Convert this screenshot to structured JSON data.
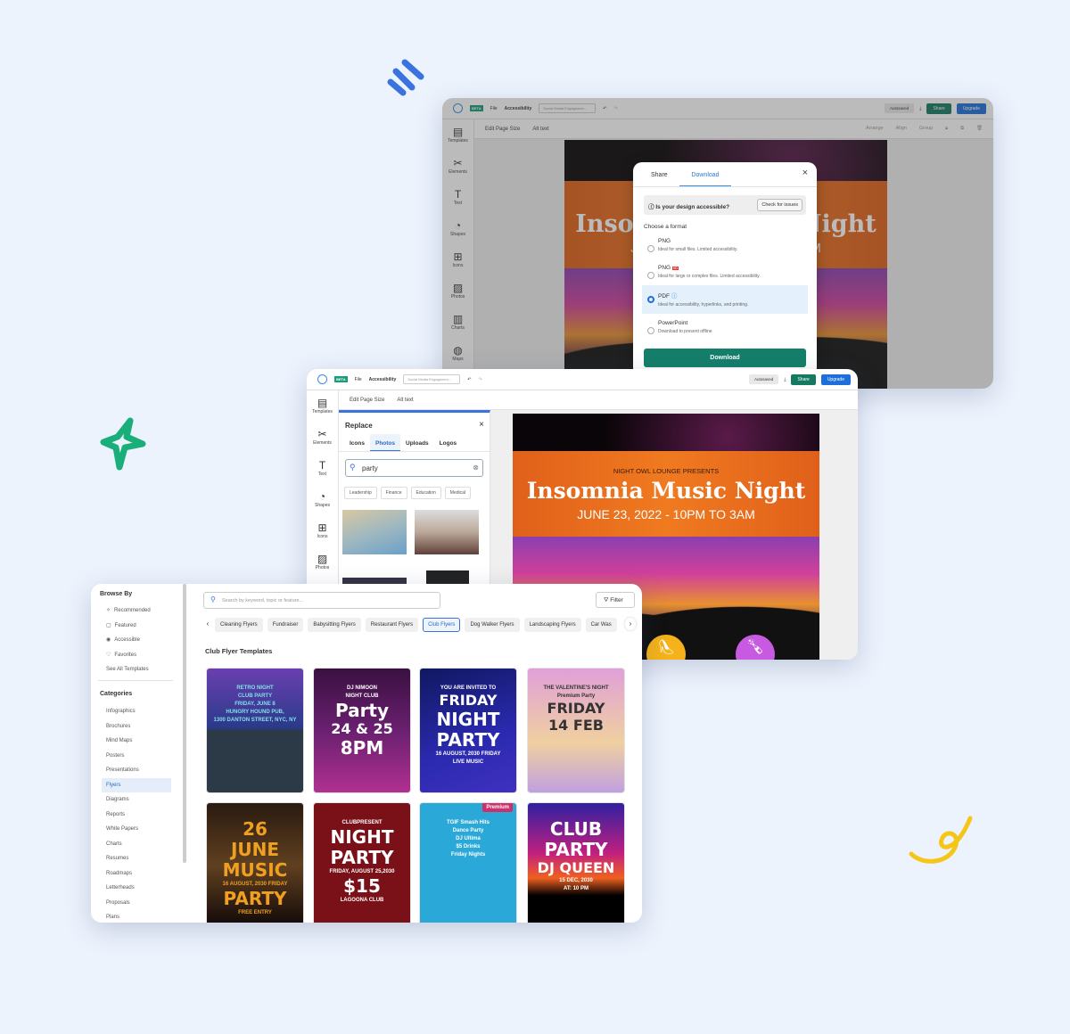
{
  "colors": {
    "background": "#edf3fd",
    "accent_green": "#167a62",
    "accent_blue": "#1e6fd9",
    "flyer_orange": "#f07a20"
  },
  "editor": {
    "beta": "BETA",
    "file_menu": "File",
    "accessibility": "Accessibility",
    "doc_name": "Social Media Engagemen...",
    "autosaved": "Autosaved",
    "share": "Share",
    "upgrade": "Upgrade",
    "toolbar": {
      "edit_page_size": "Edit Page Size",
      "alt_text": "Alt text",
      "arrange": "Arrange",
      "align": "Align",
      "group": "Group"
    },
    "sidebar": [
      {
        "label": "Templates",
        "icon": "templates-icon",
        "glyph": "▤"
      },
      {
        "label": "Elements",
        "icon": "elements-icon",
        "glyph": "✂"
      },
      {
        "label": "Text",
        "icon": "text-icon",
        "glyph": "T"
      },
      {
        "label": "Shapes",
        "icon": "shapes-icon",
        "glyph": "◔"
      },
      {
        "label": "Icons",
        "icon": "icons-icon",
        "glyph": "⊞"
      },
      {
        "label": "Photos",
        "icon": "photos-icon",
        "glyph": "▨"
      },
      {
        "label": "Charts",
        "icon": "charts-icon",
        "glyph": "▥"
      },
      {
        "label": "Maps",
        "icon": "maps-icon",
        "glyph": "◍"
      }
    ]
  },
  "flyer": {
    "presenter": "NIGHT OWL LOUNGE PRESENTS",
    "title": "Insomnia Music Night",
    "date": "JUNE 23, 2022 - 10PM TO 3AM"
  },
  "download_dialog": {
    "tabs": [
      "Share",
      "Download"
    ],
    "active_tab": "Download",
    "accessible_question": "Is your design accessible?",
    "check_button": "Check for issues",
    "choose_format": "Choose a format",
    "formats": [
      {
        "name": "PNG",
        "badge": "",
        "desc": "Ideal for small files. Limited accessibility.",
        "selected": false
      },
      {
        "name": "PNG",
        "badge": "HD",
        "desc": "Ideal for large or complex files. Limited accessibility.",
        "selected": false
      },
      {
        "name": "PDF",
        "badge": "",
        "desc": "Ideal for accessibility, hyperlinks, and printing.",
        "selected": true
      },
      {
        "name": "PowerPoint",
        "badge": "",
        "desc": "Download to present offline",
        "selected": false
      }
    ],
    "download_button": "Download"
  },
  "replace_panel": {
    "title": "Replace",
    "tabs": [
      "Icons",
      "Photos",
      "Uploads",
      "Logos"
    ],
    "active_tab": "Photos",
    "search_value": "party",
    "chips": [
      "Leadership",
      "Finance",
      "Education",
      "Medical"
    ]
  },
  "templates_page": {
    "browse_by": "Browse By",
    "browse_items": [
      {
        "label": "Recommended",
        "icon": "sparkle-icon",
        "glyph": "✧"
      },
      {
        "label": "Featured",
        "icon": "featured-icon",
        "glyph": "▢"
      },
      {
        "label": "Accessible",
        "icon": "accessible-icon",
        "glyph": "◉"
      },
      {
        "label": "Favorites",
        "icon": "heart-icon",
        "glyph": "♡"
      },
      {
        "label": "See All Templates",
        "icon": "",
        "glyph": ""
      }
    ],
    "categories_title": "Categories",
    "categories": [
      "Infographics",
      "Brochures",
      "Mind Maps",
      "Posters",
      "Presentations",
      "Flyers",
      "Diagrams",
      "Reports",
      "White Papers",
      "Charts",
      "Resumes",
      "Roadmaps",
      "Letterheads",
      "Proposals",
      "Plans"
    ],
    "active_category": "Flyers",
    "search_placeholder": "Search by keyword, topic or feature...",
    "filter": "Filter",
    "chips": [
      "Cleaning Flyers",
      "Fundraiser",
      "Babysitting Flyers",
      "Restaurant Flyers",
      "Club Flyers",
      "Dog Walker Flyers",
      "Landscaping Flyers",
      "Car Was"
    ],
    "active_chip": "Club Flyers",
    "section_title": "Club Flyer Templates",
    "templates": [
      {
        "lines": [
          "RETRO NIGHT",
          "CLUB PARTY",
          "FRIDAY, JUNE 8",
          "HUNGRY HOUND PUB,",
          "1300 DANTON STREET, NYC, NY"
        ],
        "bg": "linear-gradient(180deg,#6a3fb0 0,#2a3a8a 48%,#2c3a48 50%,#2c3a48 100%)",
        "color": "#7fe0e8"
      },
      {
        "lines": [
          "DJ NIMOON",
          "NIGHT CLUB",
          "Party",
          "24 & 25",
          "8PM"
        ],
        "bg": "linear-gradient(180deg,#3a1040,#6a2070 50%,#b03090)",
        "color": "#fff"
      },
      {
        "lines": [
          "YOU ARE INVITED TO",
          "FRIDAY",
          "NIGHT",
          "PARTY",
          "16 AUGUST, 2030 FRIDAY",
          "LIVE MUSIC"
        ],
        "bg": "linear-gradient(160deg,#101860,#2a2ab0 60%,#4030c0)",
        "color": "#fff"
      },
      {
        "lines": [
          "THE VALENTINE'S NIGHT",
          "Premium Party",
          "FRIDAY",
          "14 FEB"
        ],
        "bg": "linear-gradient(180deg,#e0a0d8,#f0d0a0 60%,#c0a0e0)",
        "color": "#333"
      },
      {
        "lines": [
          "26",
          "JUNE",
          "MUSIC",
          "16 AUGUST, 2030 FRIDAY",
          "PARTY",
          "FREE ENTRY"
        ],
        "bg": "linear-gradient(180deg,#2a1a10,#604020 50%,#100808)",
        "color": "#f0a020"
      },
      {
        "lines": [
          "CLUBPRESENT",
          "NIGHT",
          "PARTY",
          "FRIDAY, AUGUST 25,2030",
          "$15",
          "LAGOONA CLUB"
        ],
        "bg": "#7a1018",
        "color": "#fff"
      },
      {
        "lines": [
          "TGIF Smash Hits",
          "Dance Party",
          "DJ Ultima",
          "$5 Drinks",
          "Friday Nights"
        ],
        "bg": "#2aa8d8",
        "color": "#fff",
        "badge": "Premium"
      },
      {
        "lines": [
          "CLUB",
          "PARTY",
          "DJ QUEEN",
          "15 DEC, 2030",
          "AT: 10 PM"
        ],
        "bg": "linear-gradient(180deg,#3020a0,#c02080 40%,#f06020 60%,#000 74%)",
        "color": "#fff"
      }
    ]
  }
}
